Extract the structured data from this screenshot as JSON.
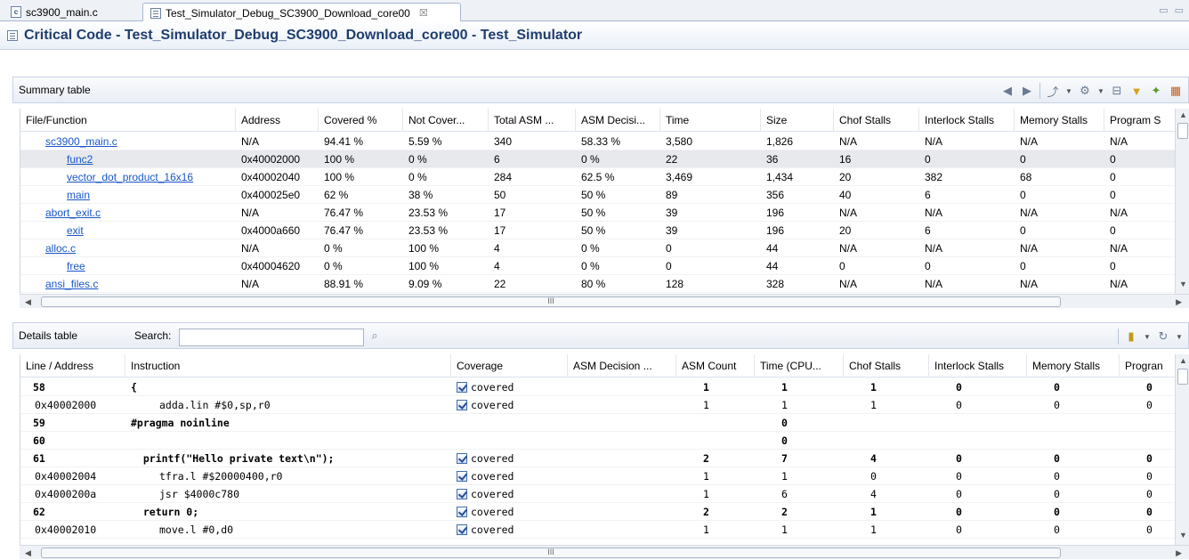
{
  "tabs": [
    {
      "label": "sc3900_main.c",
      "icon": "c-file-icon"
    },
    {
      "label": "Test_Simulator_Debug_SC3900_Download_core00",
      "icon": "form-icon",
      "close": "☒"
    }
  ],
  "page_title": "Critical Code - Test_Simulator_Debug_SC3900_Download_core00 - Test_Simulator",
  "summary": {
    "label": "Summary table",
    "columns": [
      "File/Function",
      "Address",
      "Covered %",
      "Not Cover...",
      "Total ASM ...",
      "ASM Decisi...",
      "Time",
      "Size",
      "Chof Stalls",
      "Interlock Stalls",
      "Memory Stalls",
      "Program S"
    ],
    "rows": [
      {
        "name": "sc3900_main.c",
        "indent": 0,
        "cells": [
          "N/A",
          "94.41 %",
          "5.59 %",
          "340",
          "58.33 %",
          "3,580",
          "1,826",
          "N/A",
          "N/A",
          "N/A",
          "N/A"
        ]
      },
      {
        "name": "func2",
        "indent": 1,
        "selected": true,
        "cells": [
          "0x40002000",
          "100 %",
          "0 %",
          "6",
          "0 %",
          "22",
          "36",
          "16",
          "0",
          "0",
          "0"
        ]
      },
      {
        "name": "vector_dot_product_16x16",
        "indent": 1,
        "cells": [
          "0x40002040",
          "100 %",
          "0 %",
          "284",
          "62.5 %",
          "3,469",
          "1,434",
          "20",
          "382",
          "68",
          "0"
        ]
      },
      {
        "name": "main",
        "indent": 1,
        "cells": [
          "0x400025e0",
          "62 %",
          "38 %",
          "50",
          "50 %",
          "89",
          "356",
          "40",
          "6",
          "0",
          "0"
        ]
      },
      {
        "name": "abort_exit.c",
        "indent": 0,
        "cells": [
          "N/A",
          "76.47 %",
          "23.53 %",
          "17",
          "50 %",
          "39",
          "196",
          "N/A",
          "N/A",
          "N/A",
          "N/A"
        ]
      },
      {
        "name": "exit",
        "indent": 1,
        "cells": [
          "0x4000a660",
          "76.47 %",
          "23.53 %",
          "17",
          "50 %",
          "39",
          "196",
          "20",
          "6",
          "0",
          "0"
        ]
      },
      {
        "name": "alloc.c",
        "indent": 0,
        "cells": [
          "N/A",
          "0 %",
          "100 %",
          "4",
          "0 %",
          "0",
          "44",
          "N/A",
          "N/A",
          "N/A",
          "N/A"
        ]
      },
      {
        "name": "free",
        "indent": 1,
        "cells": [
          "0x40004620",
          "0 %",
          "100 %",
          "4",
          "0 %",
          "0",
          "44",
          "0",
          "0",
          "0",
          "0"
        ]
      },
      {
        "name": "ansi_files.c",
        "indent": 0,
        "cells": [
          "N/A",
          "88.91 %",
          "9.09 %",
          "22",
          "80 %",
          "128",
          "328",
          "N/A",
          "N/A",
          "N/A",
          "N/A"
        ]
      }
    ]
  },
  "details": {
    "label": "Details table",
    "search_label": "Search:",
    "search_value": "",
    "columns": [
      "Line / Address",
      "Instruction",
      "Coverage",
      "ASM Decision ...",
      "ASM Count",
      "Time (CPU...",
      "Chof Stalls",
      "Interlock Stalls",
      "Memory Stalls",
      "Progran"
    ],
    "rows": [
      {
        "line": "58",
        "kind": "line",
        "instr": "{",
        "coverage": "covered",
        "cells": [
          "",
          "1",
          "1",
          "1",
          "0",
          "0",
          "0"
        ]
      },
      {
        "line": "0x40002000",
        "kind": "asm",
        "instr": "adda.lin #$0,sp,r0",
        "coverage": "covered",
        "cells": [
          "",
          "1",
          "1",
          "1",
          "0",
          "0",
          "0"
        ]
      },
      {
        "line": "59",
        "kind": "line",
        "instr": "#pragma noinline",
        "coverage": "",
        "cells": [
          "",
          "",
          "0",
          "",
          "",
          "",
          ""
        ]
      },
      {
        "line": "60",
        "kind": "line",
        "instr": "",
        "coverage": "",
        "cells": [
          "",
          "",
          "0",
          "",
          "",
          "",
          ""
        ]
      },
      {
        "line": "61",
        "kind": "line",
        "instr": "  printf(\"Hello private text\\n\");",
        "coverage": "covered",
        "cells": [
          "",
          "2",
          "7",
          "4",
          "0",
          "0",
          "0"
        ]
      },
      {
        "line": "0x40002004",
        "kind": "asm",
        "instr": "tfra.l #$20000400,r0",
        "coverage": "covered",
        "cells": [
          "",
          "1",
          "1",
          "0",
          "0",
          "0",
          "0"
        ]
      },
      {
        "line": "0x4000200a",
        "kind": "asm",
        "instr": "jsr $4000c780",
        "coverage": "covered",
        "cells": [
          "",
          "1",
          "6",
          "4",
          "0",
          "0",
          "0"
        ]
      },
      {
        "line": "62",
        "kind": "line",
        "instr": "  return 0;",
        "coverage": "covered",
        "cells": [
          "",
          "2",
          "2",
          "1",
          "0",
          "0",
          "0"
        ]
      },
      {
        "line": "0x40002010",
        "kind": "asm",
        "instr": "move.l #0,d0",
        "coverage": "covered",
        "cells": [
          "",
          "1",
          "1",
          "1",
          "0",
          "0",
          "0"
        ]
      }
    ]
  },
  "scroll_grip": "III",
  "icons": [
    "back-icon",
    "forward-icon",
    "export-icon",
    "settings-icon",
    "collapse-icon",
    "filter-icon",
    "pin-icon",
    "report-icon",
    "search-icon",
    "chart-icon",
    "refresh-icon"
  ]
}
